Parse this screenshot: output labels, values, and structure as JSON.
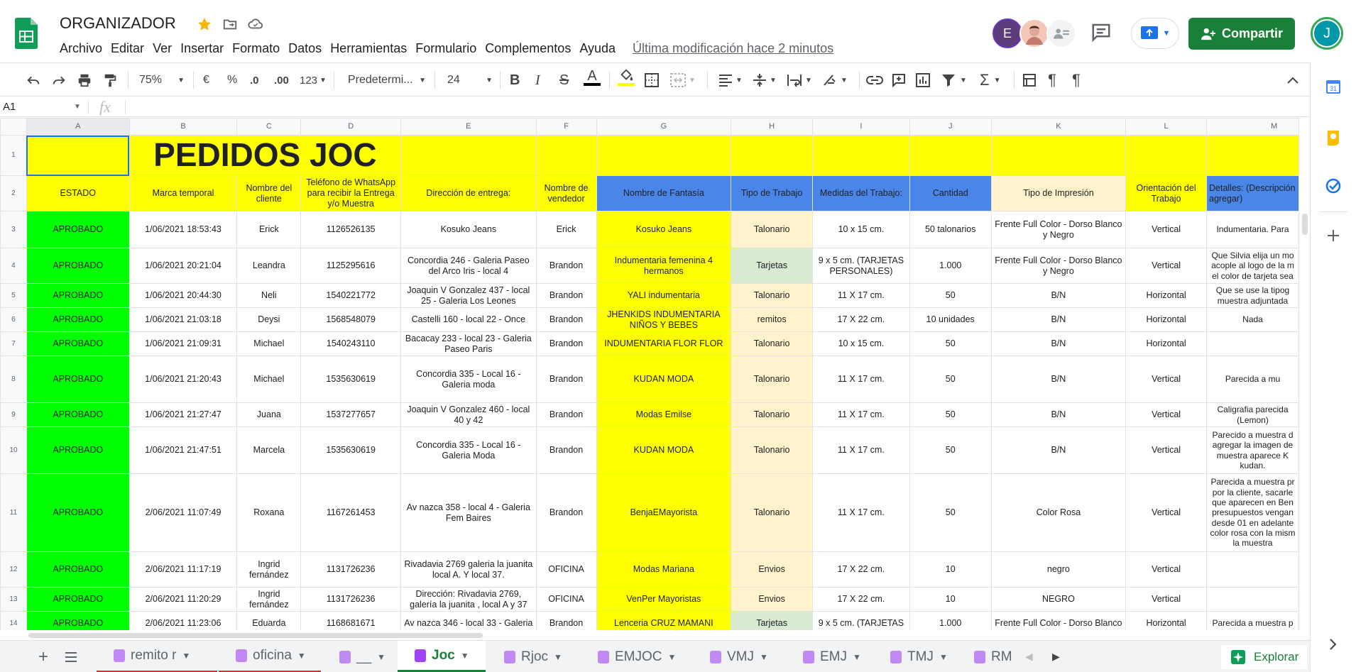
{
  "app": {
    "doc_title": "ORGANIZADOR",
    "menu": [
      "Archivo",
      "Editar",
      "Ver",
      "Insertar",
      "Formato",
      "Datos",
      "Herramientas",
      "Formulario",
      "Complementos",
      "Ayuda"
    ],
    "last_modified": "Última modificación hace 2 minutos",
    "share_label": "Compartir",
    "account_initial": "J",
    "collaborator_initial": "E"
  },
  "toolbar": {
    "zoom": "75%",
    "currency": "€",
    "percent": "%",
    "dec_decrease": ".0",
    "dec_increase": ".00",
    "more_formats": "123",
    "font": "Predetermi...",
    "font_size": "24",
    "bold": "B",
    "italic": "I",
    "strike": "S",
    "text_color": "A"
  },
  "formula_bar": {
    "name_box": "A1",
    "fx": "fx"
  },
  "sheet": {
    "columns": [
      "A",
      "B",
      "C",
      "D",
      "E",
      "F",
      "G",
      "H",
      "I",
      "J",
      "K",
      "L",
      "M"
    ],
    "title": "PEDIDOS JOC",
    "headers": [
      "ESTADO",
      "Marca temporal",
      "Nombre del cliente",
      "Teléfono de WhatsApp para recibir la Entrega y/o Muestra",
      "Dirección de entrega:",
      "Nombre de vendedor",
      "Nombre de Fantasía",
      "Tipo de Trabajo",
      "Medidas del Trabajo:",
      "Cantidad",
      "Tipo de Impresión",
      "Orientación del Trabajo",
      "Detalles: (Descripción agregar)"
    ],
    "rows": [
      {
        "n": "3",
        "c": [
          "APROBADO",
          "1/06/2021 18:53:43",
          "Erick",
          "1126526135",
          "Kosuko Jeans",
          "Erick",
          "Kosuko Jeans",
          "Talonario",
          "10 x 15 cm.",
          "50 talonarios",
          "Frente Full Color - Dorso Blanco y Negro",
          "Vertical",
          "Indumentaria. Para"
        ]
      },
      {
        "n": "4",
        "c": [
          "APROBADO",
          "1/06/2021 20:21:04",
          "Leandra",
          "1125295616",
          "Concordia 246 - Galeria Paseo del Arco Iris - local 4",
          "Brandon",
          "Indumentaria femenina 4 hermanos",
          "Tarjetas",
          "9 x 5 cm. (TARJETAS PERSONALES)",
          "1.000",
          "Frente Full Color - Dorso Blanco y Negro",
          "Vertical",
          "Que Silvia elija un mo acople al logo de la m el color de tarjeta sea"
        ]
      },
      {
        "n": "5",
        "c": [
          "APROBADO",
          "1/06/2021 20:44:30",
          "Neli",
          "1540221772",
          "Joaquin V Gonzalez 437 - local 25 - Galeria Los Leones",
          "Brandon",
          "YALI indumentaria",
          "Talonario",
          "11 X 17 cm.",
          "50",
          "B/N",
          "Horizontal",
          "Que se use la tipog muestra adjuntada"
        ]
      },
      {
        "n": "6",
        "c": [
          "APROBADO",
          "1/06/2021 21:03:18",
          "Deysi",
          "1568548079",
          "Castelli 160 - local 22 - Once",
          "Brandon",
          "JHENKIDS INDUMENTARIA NIÑOS Y BEBES",
          "remitos",
          "17 X 22 cm.",
          "10 unidades",
          "B/N",
          "Horizontal",
          "Nada"
        ]
      },
      {
        "n": "7",
        "c": [
          "APROBADO",
          "1/06/2021 21:09:31",
          "Michael",
          "1540243110",
          "Bacacay 233 - local 23 - Galeria Paseo Paris",
          "Brandon",
          "INDUMENTARIA FLOR FLOR",
          "Talonario",
          "10 x 15 cm.",
          "50",
          "B/N",
          "Horizontal",
          ""
        ]
      },
      {
        "n": "8",
        "c": [
          "APROBADO",
          "1/06/2021 21:20:43",
          "Michael",
          "1535630619",
          "Concordia 335 - Local 16 - Galeria moda",
          "Brandon",
          "KUDAN MODA",
          "Talonario",
          "11 X 17 cm.",
          "50",
          "B/N",
          "Vertical",
          "Parecida a mu"
        ]
      },
      {
        "n": "9",
        "c": [
          "APROBADO",
          "1/06/2021 21:27:47",
          "Juana",
          "1537277657",
          "Joaquin V Gonzalez 460 - local 40 y 42",
          "Brandon",
          "Modas Emilse",
          "Talonario",
          "11 X 17 cm.",
          "50",
          "B/N",
          "Vertical",
          "Caligrafia parecida (Lemon)"
        ]
      },
      {
        "n": "10",
        "c": [
          "APROBADO",
          "1/06/2021 21:47:51",
          "Marcela",
          "1535630619",
          "Concordia 335 - Local 16 - Galeria Moda",
          "Brandon",
          "KUDAN MODA",
          "Talonario",
          "11 X 17 cm.",
          "50",
          "B/N",
          "Vertical",
          "Parecido a muestra d agregar la imagen de muestra aparece K kudan."
        ]
      },
      {
        "n": "11",
        "c": [
          "APROBADO",
          "2/06/2021 11:07:49",
          "Roxana",
          "1167261453",
          "Av nazca 358 - local 4 - Galeria Fem Baires",
          "Brandon",
          "BenjaEMayorista",
          "Talonario",
          "11 X 17 cm.",
          "50",
          "Color Rosa",
          "Vertical",
          "Parecida a muestra pr por la cliente, sacarle que aparecen en Ben presupuestos vengan desde 01 en adelante color rosa con la mism la muestra"
        ]
      },
      {
        "n": "12",
        "c": [
          "APROBADO",
          "2/06/2021 11:17:19",
          "Ingrid fernández",
          "1131726236",
          "Rivadavia 2769 galeria la juanita local A.  Y local 37.",
          "OFICINA",
          "Modas Mariana",
          "Envios",
          "17 X 22 cm.",
          "10",
          "negro",
          "Vertical",
          ""
        ]
      },
      {
        "n": "13",
        "c": [
          "APROBADO",
          "2/06/2021 11:20:29",
          "Ingrid fernández",
          "1131726236",
          "Dirección: Rivadavia 2769, galería la juanita , local A y 37",
          "OFICINA",
          "VenPer Mayoristas",
          "Envios",
          "17 X 22 cm.",
          "10",
          "NEGRO",
          "Vertical",
          ""
        ]
      },
      {
        "n": "14",
        "c": [
          "APROBADO",
          "2/06/2021 11:23:06",
          "Eduarda",
          "1168681671",
          "Av nazca 346 - local 33 - Galeria",
          "Brandon",
          "Lenceria CRUZ MAMANI",
          "Tarjetas",
          "9 x 5 cm. (TARJETAS",
          "1.000",
          "Frente Full Color - Dorso Blanco",
          "Horizontal",
          "Parecida a muestra p"
        ]
      }
    ]
  },
  "tabs": [
    {
      "label": "remito r",
      "active": false
    },
    {
      "label": "oficina",
      "active": false
    },
    {
      "label": "__",
      "active": false
    },
    {
      "label": "Joc",
      "active": true
    },
    {
      "label": "Rjoc",
      "active": false
    },
    {
      "label": "EMJOC",
      "active": false
    },
    {
      "label": "VMJ",
      "active": false
    },
    {
      "label": "EMJ",
      "active": false
    },
    {
      "label": "TMJ",
      "active": false
    },
    {
      "label": "RM",
      "active": false
    }
  ],
  "explore_label": "Explorar",
  "colors": {
    "status_green": "#00ff00",
    "yellow": "#ffff00",
    "blue_header": "#4a86e8",
    "peach": "#fff2cc",
    "light_green": "#d9ead3",
    "share_green": "#188038"
  }
}
